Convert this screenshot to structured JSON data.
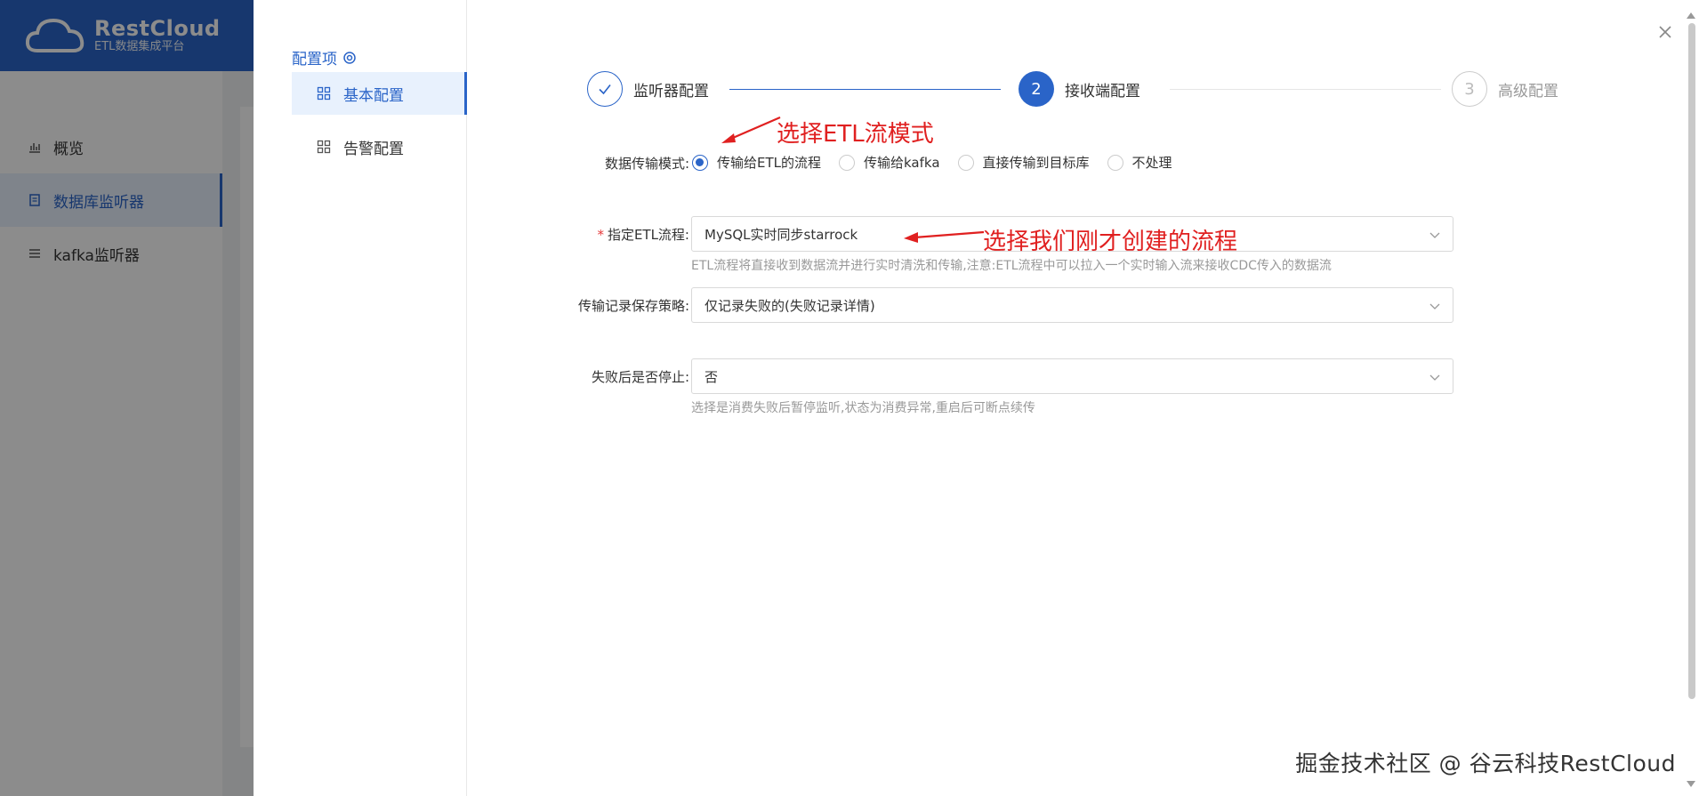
{
  "brand": {
    "name": "RestCloud",
    "subtitle": "ETL数据集成平台"
  },
  "sidebar": {
    "items": [
      {
        "label": "概览",
        "icon": "bar-chart-icon",
        "active": false
      },
      {
        "label": "数据库监听器",
        "icon": "list-icon",
        "active": true
      },
      {
        "label": "kafka监听器",
        "icon": "stack-icon",
        "active": false
      }
    ]
  },
  "config_panel": {
    "title": "配置项",
    "items": [
      {
        "label": "基本配置",
        "active": true
      },
      {
        "label": "告警配置",
        "active": false
      }
    ]
  },
  "steps": [
    {
      "index": "",
      "label": "监听器配置",
      "state": "done"
    },
    {
      "index": "2",
      "label": "接收端配置",
      "state": "current"
    },
    {
      "index": "3",
      "label": "高级配置",
      "state": "todo"
    }
  ],
  "form": {
    "transfer_mode": {
      "label": "数据传输模式:",
      "options": [
        "传输给ETL的流程",
        "传输给kafka",
        "直接传输到目标库",
        "不处理"
      ],
      "selected": "传输给ETL的流程"
    },
    "etl_flow": {
      "required": "*",
      "label": "指定ETL流程:",
      "value": "MySQL实时同步starrock",
      "hint": "ETL流程将直接收到数据流并进行实时清洗和传输,注意:ETL流程中可以拉入一个实时输入流来接收CDC传入的数据流"
    },
    "record_policy": {
      "label": "传输记录保存策略:",
      "value": "仅记录失败的(失败记录详情)"
    },
    "stop_on_fail": {
      "label": "失败后是否停止:",
      "value": "否",
      "hint": "选择是消费失败后暂停监听,状态为消费异常,重启后可断点续传"
    }
  },
  "annotations": {
    "mode_note": "选择ETL流模式",
    "flow_note": "选择我们刚才创建的流程"
  },
  "watermark": "掘金技术社区 @ 谷云科技RestCloud",
  "colors": {
    "primary": "#2a64c8",
    "annotation": "#e02020"
  }
}
